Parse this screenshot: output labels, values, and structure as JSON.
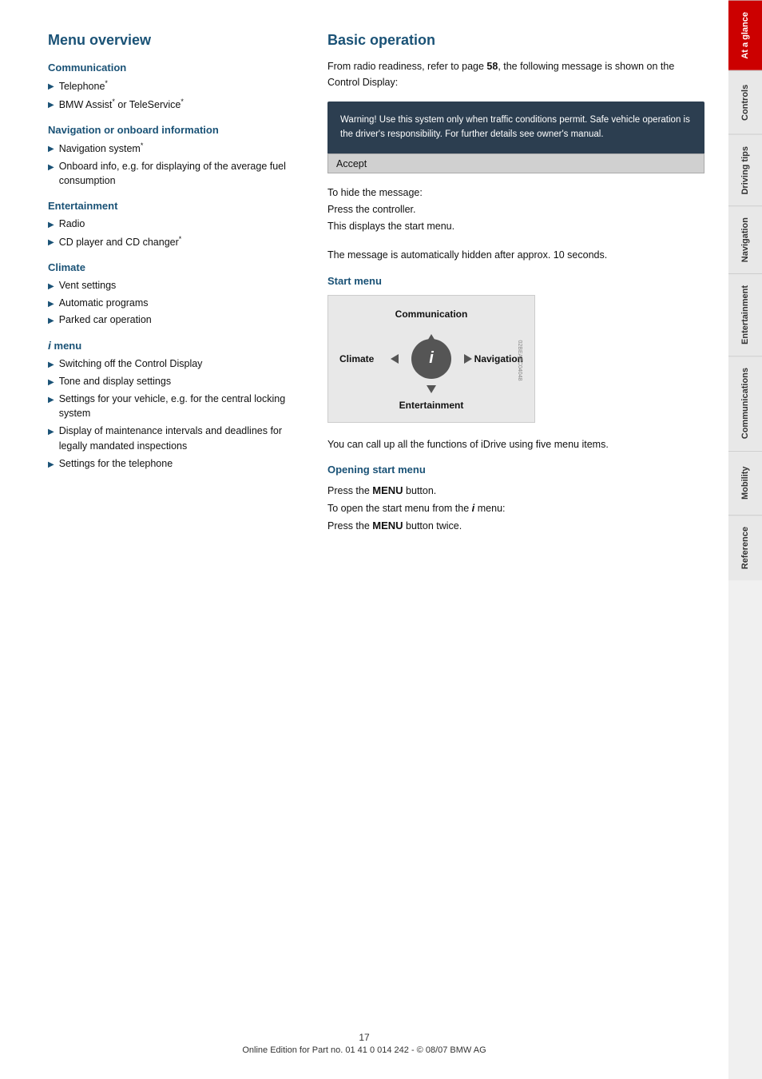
{
  "left": {
    "section_title": "Menu overview",
    "communication": {
      "title": "Communication",
      "items": [
        "Telephone*",
        "BMW Assist* or TeleService*"
      ]
    },
    "navigation": {
      "title": "Navigation or onboard information",
      "items": [
        "Navigation system*",
        "Onboard info, e.g. for displaying of the average fuel consumption"
      ]
    },
    "entertainment": {
      "title": "Entertainment",
      "items": [
        "Radio",
        "CD player and CD changer*"
      ]
    },
    "climate": {
      "title": "Climate",
      "items": [
        "Vent settings",
        "Automatic programs",
        "Parked car operation"
      ]
    },
    "i_menu": {
      "title": "i menu",
      "items": [
        "Switching off the Control Display",
        "Tone and display settings",
        "Settings for your vehicle, e.g. for the central locking system",
        "Display of maintenance intervals and deadlines for legally mandated inspections",
        "Settings for the telephone"
      ]
    }
  },
  "right": {
    "section_title": "Basic operation",
    "intro": "From radio readiness, refer to page 58, the following message is shown on the Control Display:",
    "warning_text": "Warning! Use this system only when traffic conditions permit. Safe vehicle operation is the driver's responsibility. For further details see owner's manual.",
    "accept_label": "Accept",
    "instructions": [
      "To hide the message:",
      "Press the controller.",
      "This displays the start menu.",
      "The message is automatically hidden after approx. 10 seconds."
    ],
    "start_menu": {
      "title": "Start menu",
      "labels": {
        "communication": "Communication",
        "climate": "Climate",
        "navigation": "Navigation",
        "entertainment": "Entertainment",
        "center_icon": "i"
      },
      "description": "You can call up all the functions of iDrive using five menu items."
    },
    "opening_start_menu": {
      "title": "Opening start menu",
      "line1": "Press the ",
      "menu_word": "MENU",
      "line1_end": " button.",
      "line2": "To open the start menu from the ",
      "i_icon": "i",
      "line2_end": " menu:",
      "line3": "Press the ",
      "menu_word2": "MENU",
      "line3_end": " button twice."
    }
  },
  "footer": {
    "page_number": "17",
    "copyright": "Online Edition for Part no. 01 41 0 014 242 - © 08/07 BMW AG"
  },
  "sidebar": {
    "tabs": [
      {
        "label": "At a glance",
        "active": true
      },
      {
        "label": "Controls",
        "active": false
      },
      {
        "label": "Driving tips",
        "active": false
      },
      {
        "label": "Navigation",
        "active": false
      },
      {
        "label": "Entertainment",
        "active": false
      },
      {
        "label": "Communications",
        "active": false
      },
      {
        "label": "Mobility",
        "active": false
      },
      {
        "label": "Reference",
        "active": false
      }
    ]
  }
}
